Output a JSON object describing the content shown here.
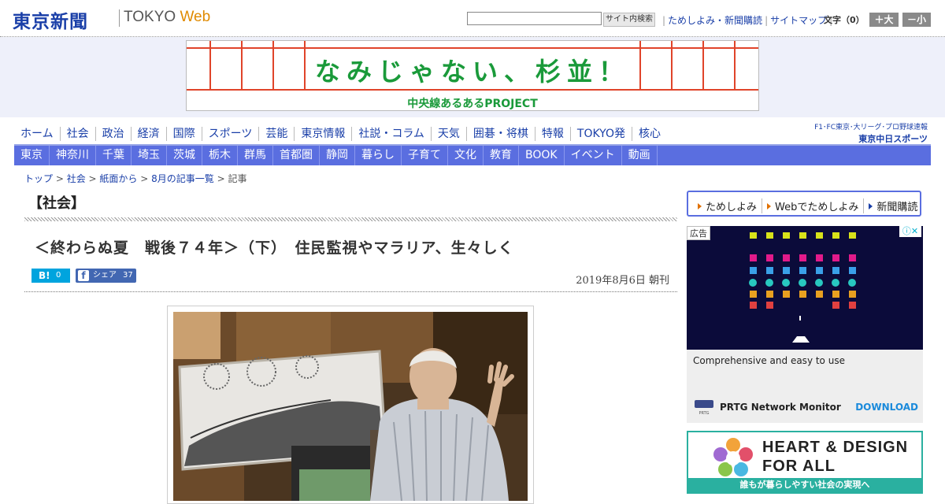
{
  "header": {
    "logo_jp": "東京新聞",
    "logo_tokyo": "TOKYO",
    "logo_web": "Web",
    "search_placeholder": "",
    "search_button": "サイト内検索",
    "links": [
      "ためしよみ・新聞購読",
      "サイトマップ"
    ],
    "fontsize_label": "文字（0）",
    "fontsize_plus": "＋大",
    "fontsize_minus": "－小"
  },
  "banner": {
    "title": "なみじゃない、杉並！",
    "subtitle": "中央線あるあるPROJECT"
  },
  "main_nav": [
    "ホーム",
    "社会",
    "政治",
    "経済",
    "国際",
    "スポーツ",
    "芸能",
    "東京情報",
    "社説・コラム",
    "天気",
    "囲碁・将棋",
    "特報",
    "TOKYO発",
    "核心"
  ],
  "chunichi": {
    "small": "F1･FC東京･大リーグ･プロ野球速報",
    "big": "東京中日スポーツ"
  },
  "sub_nav": [
    "東京",
    "神奈川",
    "千葉",
    "埼玉",
    "茨城",
    "栃木",
    "群馬",
    "首都圏",
    "静岡",
    "暮らし",
    "子育て",
    "文化",
    "教育",
    "BOOK",
    "イベント",
    "動画"
  ],
  "breadcrumb": {
    "items": [
      "トップ",
      "社会",
      "紙面から",
      "8月の記事一覧"
    ],
    "sep": " > ",
    "current": "記事"
  },
  "article": {
    "section": "【社会】",
    "title": "＜終わらぬ夏　戦後７４年＞（下）　住民監視やマラリア、生々しく",
    "hatena_label": "B!",
    "hatena_count": "0",
    "fb_label": "シェア",
    "fb_count": "37",
    "date": "2019年8月6日 朝刊"
  },
  "sidebar": {
    "subscribe_links": [
      "ためしよみ",
      "Webでためしよみ",
      "新聞購読"
    ],
    "ad": {
      "label": "広告",
      "headline": "Comprehensive and easy to use",
      "brand": "PRTG Network Monitor",
      "cta": "DOWNLOAD"
    },
    "hd_banner": {
      "line1": "HEART & DESIGN",
      "line2": "FOR ALL",
      "strip": "誰もが暮らしやすい社会の実現へ"
    }
  },
  "colors": {
    "brand_blue": "#1a3fa8",
    "nav_bar": "#5a6ee0",
    "banner_green": "#1a9a3a",
    "accent_orange": "#e08a00"
  }
}
